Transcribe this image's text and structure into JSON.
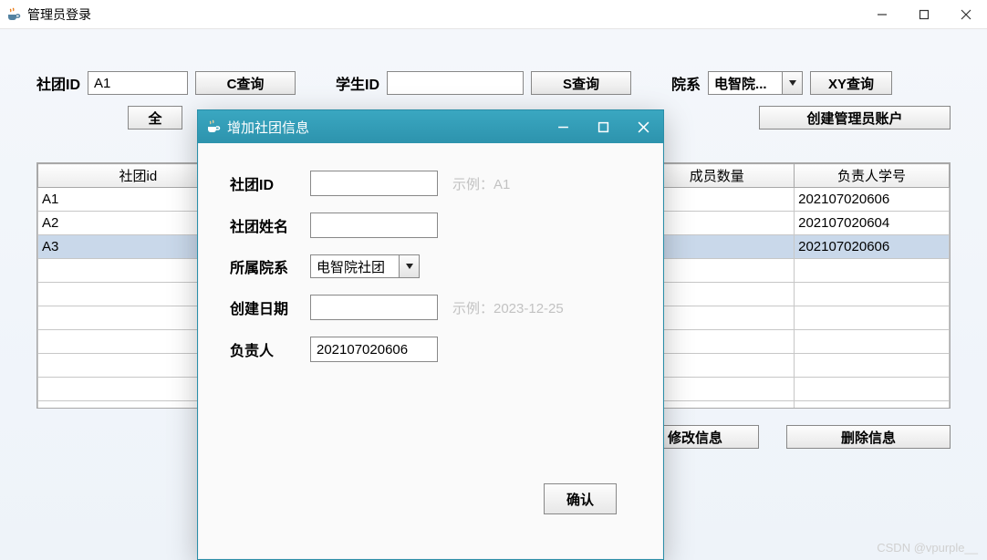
{
  "window": {
    "title": "管理员登录"
  },
  "filters": {
    "club_id_label": "社团ID",
    "club_id_value": "A1",
    "c_query_label": "C查询",
    "student_id_label": "学生ID",
    "student_id_value": "",
    "s_query_label": "S查询",
    "dept_label": "院系",
    "dept_selected": "电智院...",
    "xy_query_label": "XY查询"
  },
  "second_row": {
    "all_label": "全",
    "create_admin_label": "创建管理员账户"
  },
  "table": {
    "headers": {
      "club_id": "社团id",
      "members": "成员数量",
      "leader": "负责人学号"
    },
    "rows": [
      {
        "club_id": "A1",
        "members": "",
        "leader": "202107020606",
        "selected": false
      },
      {
        "club_id": "A2",
        "members": "",
        "leader": "202107020604",
        "selected": false
      },
      {
        "club_id": "A3",
        "members": "",
        "leader": "202107020606",
        "selected": true
      }
    ]
  },
  "actions": {
    "edit_label": "修改信息",
    "delete_label": "删除信息"
  },
  "modal": {
    "title": "增加社团信息",
    "fields": {
      "club_id_label": "社团ID",
      "club_id_value": "",
      "club_id_hint": "示例：A1",
      "club_name_label": "社团姓名",
      "club_name_value": "",
      "dept_label": "所属院系",
      "dept_selected": "电智院社团",
      "create_date_label": "创建日期",
      "create_date_value": "",
      "create_date_hint": "示例：2023-12-25",
      "leader_label": "负责人",
      "leader_value": "202107020606"
    },
    "confirm_label": "确认"
  },
  "watermark": "CSDN @vpurple__"
}
